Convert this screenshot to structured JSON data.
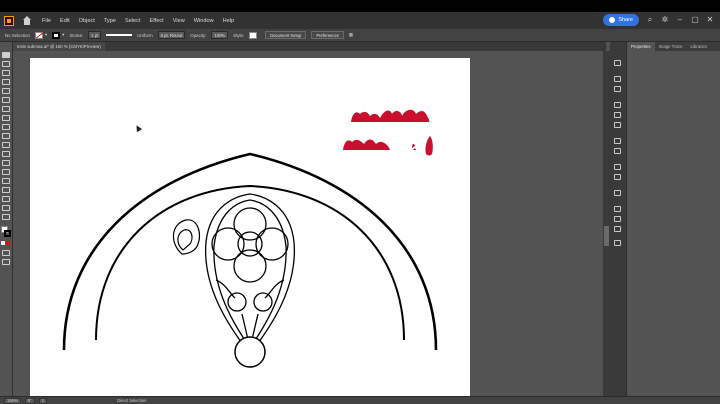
{
  "menubar": {
    "items": [
      "File",
      "Edit",
      "Object",
      "Type",
      "Select",
      "Effect",
      "View",
      "Window",
      "Help"
    ],
    "share_label": "Share"
  },
  "controlbar": {
    "selection_label": "No Selection",
    "stroke_label": "Stroke:",
    "stroke_value": "1 pt",
    "profile_value": "Uniform",
    "brush_value": "5 pt. Round",
    "opacity_label": "Opacity:",
    "opacity_value": "100%",
    "style_label": "Style:",
    "document_setup": "Document Setup",
    "preferences": "Preferences"
  },
  "document": {
    "tab_title": "tenis subrnsa.ai* @ 150 % (CMYK/Preview)"
  },
  "panel": {
    "tabs": [
      "Properties",
      "Image Trace",
      "Libraries"
    ]
  },
  "statusbar": {
    "zoom": "150%",
    "angle": "0°",
    "artboard": "1",
    "tool_name": "Direct Selection"
  },
  "colors": {
    "red_shapes": "#c8102e",
    "accent": "#2f72e0"
  },
  "icons": [
    "home-icon",
    "search-icon",
    "gear-icon",
    "minimize-icon",
    "maximize-icon",
    "close-icon"
  ]
}
